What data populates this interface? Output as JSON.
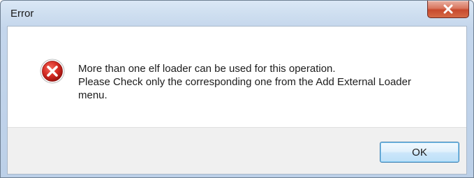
{
  "dialog": {
    "title": "Error",
    "icon": "error-icon",
    "message_lines": [
      "More than one elf loader can be used for this operation.",
      "Please Check only the corresponding one from the Add External Loader",
      "menu."
    ],
    "ok_label": "OK",
    "close_icon": "close-icon"
  },
  "colors": {
    "close_button": "#c74a2e",
    "error_icon": "#c8201f",
    "ok_border": "#3c7fb1"
  }
}
